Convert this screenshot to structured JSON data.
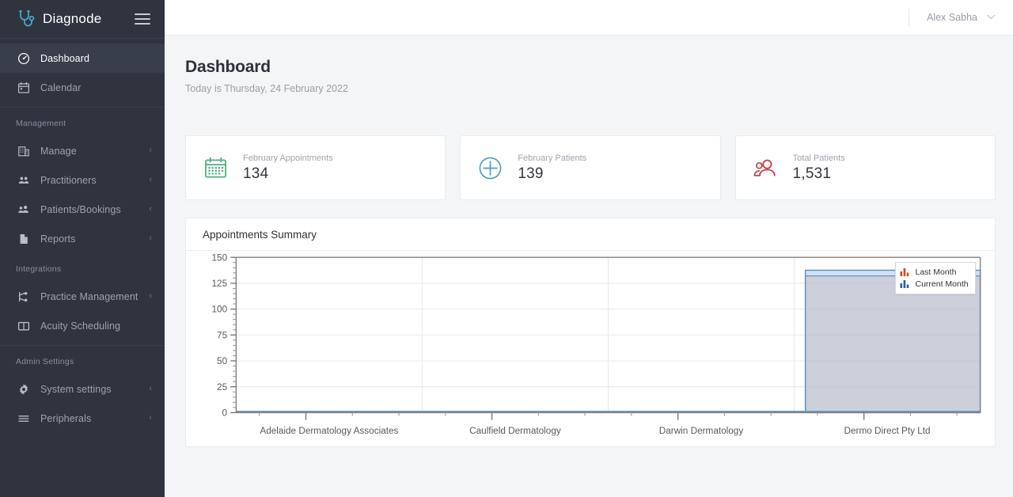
{
  "brand": {
    "name": "Diagnode",
    "logo_icon": "stethoscope-icon",
    "menu_icon": "hamburger-icon"
  },
  "topbar": {
    "user_name": "Alex Sabha",
    "caret_icon": "chevron-down-icon"
  },
  "page": {
    "title": "Dashboard",
    "subtitle": "Today is Thursday, 24 February 2022"
  },
  "sidebar": {
    "items": [
      {
        "label": "Dashboard",
        "icon": "dashboard-gauge-icon",
        "active": true,
        "chevron": ""
      },
      {
        "label": "Calendar",
        "icon": "calendar-icon",
        "active": false,
        "chevron": ""
      }
    ],
    "groups": [
      {
        "label": "Management",
        "items": [
          {
            "label": "Manage",
            "icon": "building-icon",
            "chevron": "‹"
          },
          {
            "label": "Practitioners",
            "icon": "users-icon",
            "chevron": "‹"
          },
          {
            "label": "Patients/Bookings",
            "icon": "patient-group-icon",
            "chevron": "‹"
          },
          {
            "label": "Reports",
            "icon": "document-icon",
            "chevron": "‹"
          }
        ]
      },
      {
        "label": "Integrations",
        "items": [
          {
            "label": "Practice Management",
            "icon": "sitemap-icon",
            "chevron": "‹"
          },
          {
            "label": "Acuity Scheduling",
            "icon": "book-icon",
            "chevron": ""
          }
        ]
      },
      {
        "label": "Admin Settings",
        "items": [
          {
            "label": "System settings",
            "icon": "gear-icon",
            "chevron": "‹"
          },
          {
            "label": "Peripherals",
            "icon": "list-icon",
            "chevron": "‹"
          }
        ]
      }
    ]
  },
  "stats": [
    {
      "label": "February Appointments",
      "value": "134",
      "icon": "calendar-icon",
      "color": "#4caf7d"
    },
    {
      "label": "February Patients",
      "value": "139",
      "icon": "plus-circle-icon",
      "color": "#4b9fc4"
    },
    {
      "label": "Total Patients",
      "value": "1,531",
      "icon": "people-icon",
      "color": "#c9393f"
    }
  ],
  "chart_card": {
    "title": "Appointments Summary"
  },
  "chart_data": {
    "type": "bar",
    "title": "Appointments Summary",
    "xlabel": "",
    "ylabel": "",
    "ylim": [
      0,
      150
    ],
    "yticks": [
      0,
      25,
      50,
      75,
      100,
      125,
      150
    ],
    "ytick_labels": [
      "0",
      "25",
      "50",
      "75",
      "100",
      "125",
      "150"
    ],
    "grid": true,
    "legend_position": "top-right",
    "categories": [
      "Adelaide Dermatology Associates",
      "Caulfield Dermatology",
      "Darwin Dermatology",
      "Dermo Direct Pty Ltd"
    ],
    "series": [
      {
        "name": "Last Month",
        "color": "#d4491f",
        "values": [
          0,
          0,
          0,
          0
        ]
      },
      {
        "name": "Current Month",
        "color": "#4a7ebb",
        "values": [
          1,
          1,
          1,
          1
        ]
      }
    ],
    "selection": {
      "label": "Dermo Direct Pty Ltd",
      "fill": "#aeb3c4",
      "border": "#5b87c7"
    }
  }
}
